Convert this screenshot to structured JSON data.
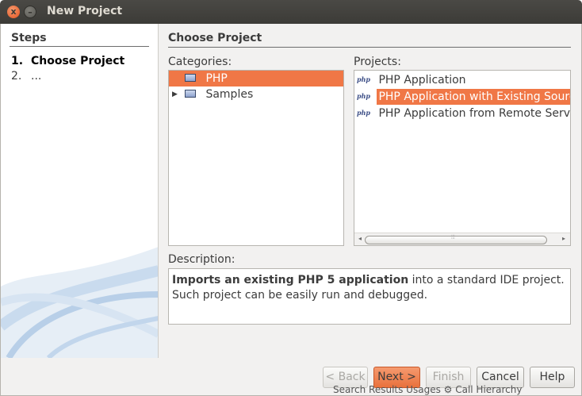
{
  "window": {
    "title": "New Project",
    "close_glyph": "x",
    "minimize_glyph": "–"
  },
  "steps": {
    "title": "Steps",
    "items": [
      {
        "num": "1.",
        "label": "Choose Project"
      },
      {
        "num": "2.",
        "label": "..."
      }
    ]
  },
  "section_title": "Choose Project",
  "categories": {
    "label": "Categories:",
    "items": [
      {
        "label": "PHP",
        "selected": true,
        "icon": "folder-icon"
      },
      {
        "label": "Samples",
        "selected": false,
        "icon": "folder-icon",
        "expander": "▶"
      }
    ]
  },
  "projects": {
    "label": "Projects:",
    "icon_text": "php",
    "items": [
      {
        "label": "PHP Application",
        "selected": false
      },
      {
        "label": "PHP Application with Existing Sources",
        "selected": true
      },
      {
        "label": "PHP Application from Remote Server",
        "selected": false
      }
    ],
    "scroll_left": "◂",
    "scroll_right": "▸",
    "scroll_grip": "⦙⦙⦙"
  },
  "description": {
    "label": "Description:",
    "bold": "Imports an existing PHP 5 application",
    "rest": " into a standard IDE project. Such project can be easily run and debugged."
  },
  "buttons": {
    "back": "< Back",
    "next": "Next >",
    "finish": "Finish",
    "cancel": "Cancel",
    "help": "Help"
  },
  "background_peek": "Search Results    Usages  ⚙  Call Hierarchy",
  "colors": {
    "selection": "#f07746",
    "titlebar": "#3c3b37",
    "close_button": "#e2531f"
  }
}
